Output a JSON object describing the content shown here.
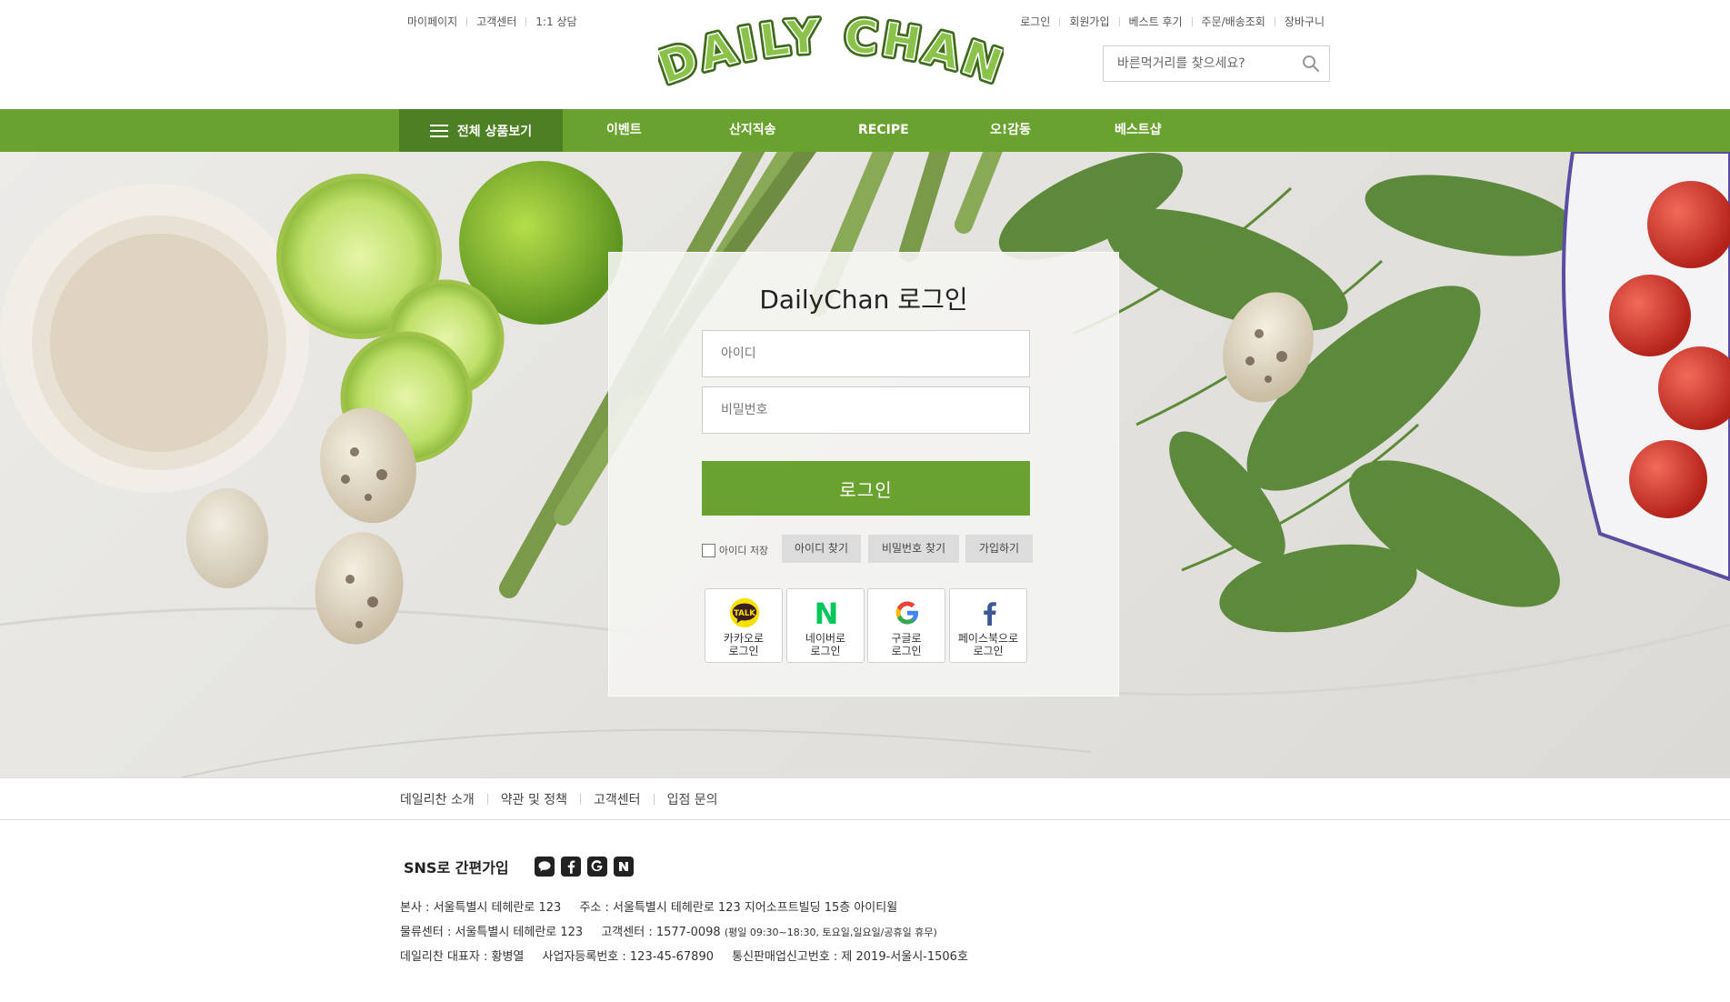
{
  "header": {
    "util_left": [
      "마이페이지",
      "고객센터",
      "1:1 상담"
    ],
    "util_right": [
      "로그인",
      "회원가입",
      "베스트 후기",
      "주문/배송조회",
      "장바구니"
    ],
    "logo_text": "DAILY CHAN",
    "search": {
      "placeholder": "바른먹거리를 찾으세요?"
    }
  },
  "nav": {
    "all_products": "전체 상품보기",
    "items": [
      "이벤트",
      "산지직송",
      "RECIPE",
      "오!감동",
      "베스트샵"
    ]
  },
  "login": {
    "title": "DailyChan 로그인",
    "id_placeholder": "아이디",
    "pw_placeholder": "비밀번호",
    "submit": "로그인",
    "save_id": "아이디 저장",
    "find_id": "아이디 찾기",
    "find_pw": "비밀번호 찾기",
    "signup": "가입하기",
    "kakao_badge": "TALK",
    "naver_badge": "N",
    "sns": [
      {
        "label": "카카오로\n로그인",
        "icon": "kakao-talk-icon"
      },
      {
        "label": "네이버로\n로그인",
        "icon": "naver-icon"
      },
      {
        "label": "구글로\n로그인",
        "icon": "google-icon"
      },
      {
        "label": "페이스북으로\n로그인",
        "icon": "facebook-icon"
      }
    ]
  },
  "footer": {
    "links": [
      "데일리찬 소개",
      "약관 및 정책",
      "고객센터",
      "입점 문의"
    ],
    "sns_title": "SNS로 간편가입",
    "sns_icons": [
      "kakao-icon",
      "facebook-icon",
      "google-icon",
      "naver-icon"
    ],
    "line1_a": "본사 : 서울특별시 테헤란로 123",
    "line1_b": "주소 : 서울특별시 테헤란로 123 지어소프트빌딩 15층 아이티윌",
    "line2_a": "물류센터 : 서울특별시 테헤란로 123",
    "line2_b": "고객센터 : 1577-0098",
    "line2_c": "(평일 09:30~18:30, 토요일,일요일/공휴일 휴무)",
    "line3_a": "데일리찬 대표자 : 황병열",
    "line3_b": "사업자등록번호 : 123-45-67890",
    "line3_c": "통신판매업신고번호 : 제 2019-서울시-1506호"
  },
  "colors": {
    "brand_green": "#69a22f",
    "nav_dark_green": "#4d7f24"
  }
}
